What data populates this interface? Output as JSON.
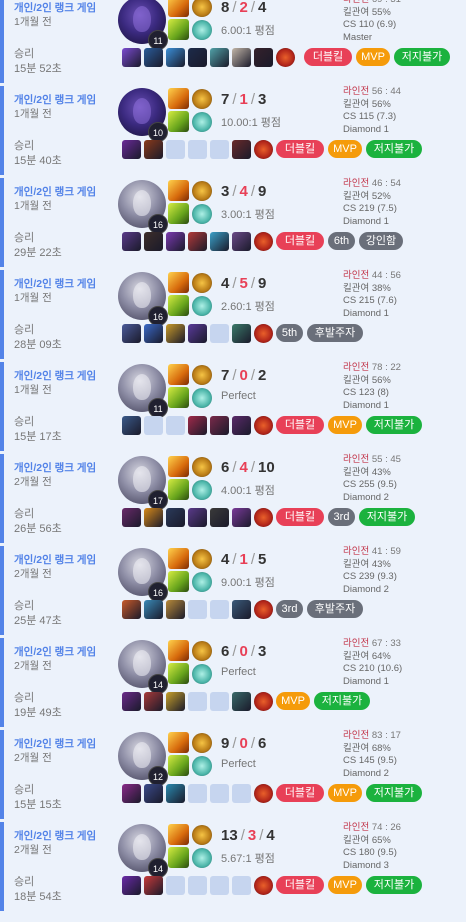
{
  "palette": {
    "accent": "#5383e8",
    "death": "#e84057",
    "badge_red": "#e84057",
    "badge_orange": "#f59b0a",
    "badge_green": "#1bb23e",
    "badge_gray": "#6a6f7a",
    "empty_slot": "#c6d5ef"
  },
  "matches": [
    {
      "queue": "개인/2인 랭크 게임",
      "ago": "1개월 전",
      "result": "승리",
      "duration": "15분 52초",
      "level": "11",
      "kills": "8",
      "deaths": "2",
      "assists": "4",
      "ratio": "6.00:1 평점",
      "lane": "라인전",
      "lane_score": "69 : 31",
      "kill_participation": "킬관여 55%",
      "cs": "CS 110 (6.9)",
      "rank": "Master",
      "dark": true,
      "items": [
        "#7b4bd1",
        "#2a5c9a",
        "#3a8fd8",
        "#1d2b4a",
        "#51a2a8",
        "#c2b6a8",
        "#35212b"
      ],
      "badges": [
        {
          "text": "더블킬",
          "color": "red"
        },
        {
          "text": "MVP",
          "color": "orange"
        },
        {
          "text": "저지불가",
          "color": "green"
        }
      ]
    },
    {
      "queue": "개인/2인 랭크 게임",
      "ago": "1개월 전",
      "result": "승리",
      "duration": "15분 40초",
      "level": "10",
      "kills": "7",
      "deaths": "1",
      "assists": "3",
      "ratio": "10.00:1 평점",
      "lane": "라인전",
      "lane_score": "56 : 44",
      "kill_participation": "킬관여 56%",
      "cs": "CS 115 (7.3)",
      "rank": "Diamond 1",
      "dark": true,
      "items": [
        "#6a2a98",
        "#8a3a1a",
        "",
        "",
        "",
        "#6a2a2a"
      ],
      "badges": [
        {
          "text": "더블킬",
          "color": "red"
        },
        {
          "text": "MVP",
          "color": "orange"
        },
        {
          "text": "저지불가",
          "color": "green"
        }
      ]
    },
    {
      "queue": "개인/2인 랭크 게임",
      "ago": "1개월 전",
      "result": "승리",
      "duration": "29분 22초",
      "level": "16",
      "kills": "3",
      "deaths": "4",
      "assists": "9",
      "ratio": "3.00:1 평점",
      "lane": "라인전",
      "lane_score": "46 : 54",
      "kill_participation": "킬관여 52%",
      "cs": "CS 219 (7.5)",
      "rank": "Diamond 1",
      "dark": false,
      "items": [
        "#5a3a8a",
        "#3d2e2a",
        "#7a3ab0",
        "#b23a3a",
        "#3aa0c8",
        "#6a4a88"
      ],
      "badges": [
        {
          "text": "더블킬",
          "color": "red"
        },
        {
          "text": "6th",
          "color": "gray"
        },
        {
          "text": "강인함",
          "color": "gray"
        }
      ]
    },
    {
      "queue": "개인/2인 랭크 게임",
      "ago": "1개월 전",
      "result": "승리",
      "duration": "28분 09초",
      "level": "16",
      "kills": "4",
      "deaths": "5",
      "assists": "9",
      "ratio": "2.60:1 평점",
      "lane": "라인전",
      "lane_score": "44 : 56",
      "kill_participation": "킬관여 38%",
      "cs": "CS 215 (7.6)",
      "rank": "Diamond 1",
      "dark": false,
      "items": [
        "#4a5a9a",
        "#3a6ac8",
        "#c89a2a",
        "#5a3a9a",
        "",
        "#3a7a6a"
      ],
      "badges": [
        {
          "text": "5th",
          "color": "gray"
        },
        {
          "text": "후발주자",
          "color": "gray"
        }
      ]
    },
    {
      "queue": "개인/2인 랭크 게임",
      "ago": "1개월 전",
      "result": "승리",
      "duration": "15분 17초",
      "level": "11",
      "kills": "7",
      "deaths": "0",
      "assists": "2",
      "ratio": "Perfect",
      "lane": "라인전",
      "lane_score": "78 : 22",
      "kill_participation": "킬관여 56%",
      "cs": "CS 123 (8)",
      "rank": "Diamond 1",
      "dark": false,
      "items": [
        "#3a5a8a",
        "",
        "",
        "#a02a4a",
        "#7a2a4a",
        "#5a2a6a"
      ],
      "badges": [
        {
          "text": "더블킬",
          "color": "red"
        },
        {
          "text": "MVP",
          "color": "orange"
        },
        {
          "text": "저지불가",
          "color": "green"
        }
      ]
    },
    {
      "queue": "개인/2인 랭크 게임",
      "ago": "2개월 전",
      "result": "승리",
      "duration": "26분 56초",
      "level": "17",
      "kills": "6",
      "deaths": "4",
      "assists": "10",
      "ratio": "4.00:1 평점",
      "lane": "라인전",
      "lane_score": "55 : 45",
      "kill_participation": "킬관여 43%",
      "cs": "CS 255 (9.5)",
      "rank": "Diamond 2",
      "dark": false,
      "items": [
        "#6a2a6a",
        "#d88a1a",
        "#2a3a5a",
        "#5a3a8a",
        "#3a3a3a",
        "#7a3a9a"
      ],
      "badges": [
        {
          "text": "더블킬",
          "color": "red"
        },
        {
          "text": "3rd",
          "color": "gray"
        },
        {
          "text": "저지불가",
          "color": "green"
        }
      ]
    },
    {
      "queue": "개인/2인 랭크 게임",
      "ago": "2개월 전",
      "result": "승리",
      "duration": "25분 47초",
      "level": "16",
      "kills": "4",
      "deaths": "1",
      "assists": "5",
      "ratio": "9.00:1 평점",
      "lane": "라인전",
      "lane_score": "41 : 59",
      "kill_participation": "킬관여 43%",
      "cs": "CS 239 (9.3)",
      "rank": "Diamond 2",
      "dark": false,
      "items": [
        "#c85a2a",
        "#3a8ab8",
        "#b88a3a",
        "",
        "",
        "#3a5a7a"
      ],
      "badges": [
        {
          "text": "3rd",
          "color": "gray"
        },
        {
          "text": "후발주자",
          "color": "gray"
        }
      ]
    },
    {
      "queue": "개인/2인 랭크 게임",
      "ago": "2개월 전",
      "result": "승리",
      "duration": "19분 49초",
      "level": "14",
      "kills": "6",
      "deaths": "0",
      "assists": "3",
      "ratio": "Perfect",
      "lane": "라인전",
      "lane_score": "67 : 33",
      "kill_participation": "킬관여 64%",
      "cs": "CS 210 (10.6)",
      "rank": "Diamond 1",
      "dark": false,
      "items": [
        "#6a2a8a",
        "#a83a3a",
        "#c8a02a",
        "",
        "",
        "#3a6a6a"
      ],
      "badges": [
        {
          "text": "MVP",
          "color": "orange"
        },
        {
          "text": "저지불가",
          "color": "green"
        }
      ]
    },
    {
      "queue": "개인/2인 랭크 게임",
      "ago": "2개월 전",
      "result": "승리",
      "duration": "15분 15초",
      "level": "12",
      "kills": "9",
      "deaths": "0",
      "assists": "6",
      "ratio": "Perfect",
      "lane": "라인전",
      "lane_score": "83 : 17",
      "kill_participation": "킬관여 68%",
      "cs": "CS 145 (9.5)",
      "rank": "Diamond 2",
      "dark": false,
      "items": [
        "#8a2a8a",
        "#3a4a8a",
        "#2a8ab0",
        "",
        "",
        ""
      ],
      "badges": [
        {
          "text": "더블킬",
          "color": "red"
        },
        {
          "text": "MVP",
          "color": "orange"
        },
        {
          "text": "저지불가",
          "color": "green"
        }
      ]
    },
    {
      "queue": "개인/2인 랭크 게임",
      "ago": "2개월 전",
      "result": "승리",
      "duration": "18분 54초",
      "level": "14",
      "kills": "13",
      "deaths": "3",
      "assists": "4",
      "ratio": "5.67:1 평점",
      "lane": "라인전",
      "lane_score": "74 : 26",
      "kill_participation": "킬관여 65%",
      "cs": "CS 180 (9.5)",
      "rank": "Diamond 3",
      "dark": false,
      "items": [
        "#6a2aa8",
        "#c83a3a",
        "",
        "",
        "",
        ""
      ],
      "badges": [
        {
          "text": "더블킬",
          "color": "red"
        },
        {
          "text": "MVP",
          "color": "orange"
        },
        {
          "text": "저지불가",
          "color": "green"
        }
      ]
    }
  ]
}
